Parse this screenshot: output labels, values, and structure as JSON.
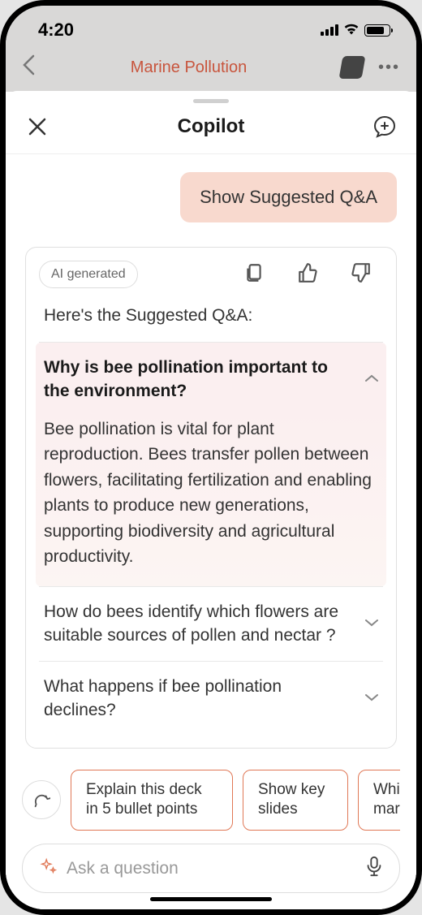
{
  "statusbar": {
    "time": "4:20"
  },
  "background": {
    "title": "Marine Pollution",
    "more": "•••"
  },
  "sheet": {
    "title": "Copilot"
  },
  "conversation": {
    "user_message": "Show Suggested Q&A",
    "ai_badge": "AI generated",
    "ai_intro": "Here's the Suggested Q&A:",
    "qa": [
      {
        "question": "Why is bee pollination important to the environment?",
        "answer": "Bee pollination is vital for plant reproduction. Bees transfer pollen between flowers, facilitating fertilization and enabling plants to produce new generations, supporting biodiversity and agricultural productivity.",
        "expanded": true
      },
      {
        "question": "How do bees identify which flowers are suitable sources of pollen and nectar ?",
        "expanded": false
      },
      {
        "question": "What happens if bee pollination declines?",
        "expanded": false
      }
    ]
  },
  "suggestions": [
    "Explain this deck in 5 bullet points",
    "Show key slides",
    "Which mari"
  ],
  "input": {
    "placeholder": "Ask a question"
  }
}
